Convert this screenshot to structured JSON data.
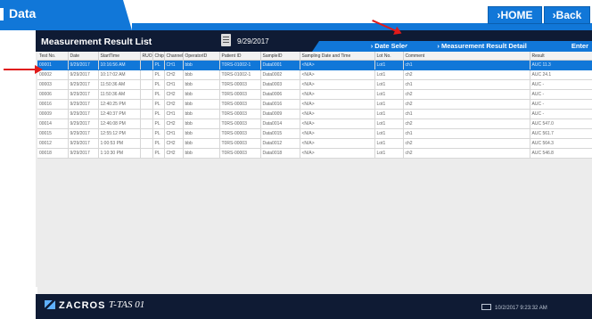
{
  "header": {
    "title": "Data",
    "home_label": "›HOME",
    "back_label": "›Back"
  },
  "panel": {
    "title": "Measurement Result List",
    "date": "9/29/2017",
    "date_select_label": "› Date Select  Enter",
    "detail_label": "› Measurement Result Detail",
    "detail_enter": "Enter"
  },
  "table": {
    "columns": [
      "Test No.",
      "Date",
      "StartTime",
      "RUO",
      "Chip",
      "Channel",
      "OperatorID",
      "Patient ID",
      "SampleID",
      "Sampling Date and Time",
      "Lot No.",
      "Comment",
      "Result"
    ],
    "rows": [
      [
        "00001",
        "9/29/2017",
        "10:16:56 AM",
        "",
        "PL",
        "CH1",
        "bbb",
        "T0RS-01002-1",
        "Data0001",
        "<N/A>",
        "Lot1",
        "ch1",
        "AUC 11.3"
      ],
      [
        "00002",
        "9/29/2017",
        "10:17:02 AM",
        "",
        "PL",
        "CH2",
        "bbb",
        "T0RS-01002-1",
        "Data0002",
        "<N/A>",
        "Lot1",
        "ch2",
        "AUC 24.1"
      ],
      [
        "00003",
        "9/29/2017",
        "11:50:36 AM",
        "",
        "PL",
        "CH1",
        "bbb",
        "T0RS-00003",
        "Data0003",
        "<N/A>",
        "Lot1",
        "ch1",
        "AUC -"
      ],
      [
        "00006",
        "9/29/2017",
        "11:50:36 AM",
        "",
        "PL",
        "CH2",
        "bbb",
        "T0RS-00003",
        "Data0006",
        "<N/A>",
        "Lot1",
        "ch2",
        "AUC -"
      ],
      [
        "00016",
        "9/29/2017",
        "12:40:25 PM",
        "",
        "PL",
        "CH2",
        "bbb",
        "T0RS-00003",
        "Data0016",
        "<N/A>",
        "Lot1",
        "ch2",
        "AUC -"
      ],
      [
        "00009",
        "9/29/2017",
        "12:40:37 PM",
        "",
        "PL",
        "CH1",
        "bbb",
        "T0RS-00003",
        "Data0009",
        "<N/A>",
        "Lot1",
        "ch1",
        "AUC -"
      ],
      [
        "00014",
        "9/29/2017",
        "12:46:08 PM",
        "",
        "PL",
        "CH2",
        "bbb",
        "T0RS-00003",
        "Data0014",
        "<N/A>",
        "Lot1",
        "ch2",
        "AUC 547.0"
      ],
      [
        "00015",
        "9/29/2017",
        "12:55:12 PM",
        "",
        "PL",
        "CH1",
        "bbb",
        "T0RS-00003",
        "Data0015",
        "<N/A>",
        "Lot1",
        "ch1",
        "AUC 561.7"
      ],
      [
        "00012",
        "9/29/2017",
        "1:00:53 PM",
        "",
        "PL",
        "CH2",
        "bbb",
        "T0RS-00003",
        "Data0012",
        "<N/A>",
        "Lot1",
        "ch2",
        "AUC 564.3"
      ],
      [
        "00018",
        "9/29/2017",
        "1:10:30 PM",
        "",
        "PL",
        "CH2",
        "bbb",
        "T0RS-00003",
        "Data0018",
        "<N/A>",
        "Lot1",
        "ch2",
        "AUC 546.8"
      ]
    ],
    "selected_row": 0
  },
  "footer": {
    "brand": "ZACROS",
    "product": "T-TAS 01",
    "datetime": "10/2/2017 9:23:32 AM"
  },
  "colors": {
    "accent": "#1177d8",
    "navy": "#0f1b34",
    "annotation_arrow": "#e01a1a"
  }
}
